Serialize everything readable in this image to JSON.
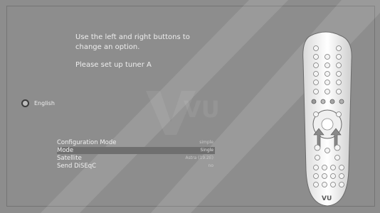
{
  "help_text": "Use the left and right buttons to\nchange an option.",
  "tuner_prompt": "Please set up tuner A",
  "language": {
    "label": "English",
    "icon": "language-radio-icon"
  },
  "menu": {
    "rows": [
      {
        "label": "Configuration Mode",
        "value": "simple"
      },
      {
        "label": "Mode",
        "value": "Single"
      },
      {
        "label": "Satellite",
        "value": "Astra (19.2E)"
      },
      {
        "label": "Send DiSEqC",
        "value": "no"
      }
    ],
    "selected_index": 1
  },
  "remote": {
    "brand": "VU",
    "icons": [
      "remote-control-icon",
      "left-arrow-icon",
      "right-arrow-icon"
    ]
  },
  "watermark": {
    "logo": "VU"
  },
  "colors": {
    "background": "#8d8d8d",
    "selection": "#6f6f6f",
    "text": "#ffffff"
  }
}
